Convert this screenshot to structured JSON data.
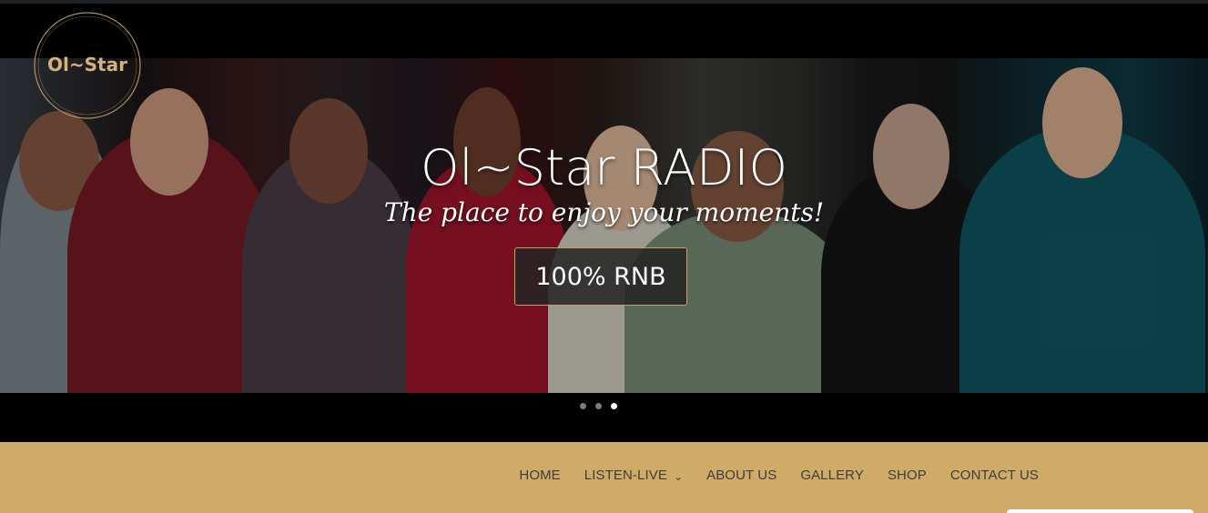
{
  "logo": {
    "text": "Ol~Star"
  },
  "hero": {
    "title": "Ol~Star RADIO",
    "tagline": "The place to enjoy your moments!",
    "cta_label": "100% RNB",
    "slides": {
      "count": 3,
      "active_index": 2
    }
  },
  "nav": {
    "items": [
      {
        "label": "HOME"
      },
      {
        "label": "LISTEN-LIVE",
        "has_dropdown": true,
        "icon": "chevron-down-icon"
      },
      {
        "label": "ABOUT US"
      },
      {
        "label": "GALLERY"
      },
      {
        "label": "SHOP"
      },
      {
        "label": "CONTACT US"
      }
    ]
  },
  "colors": {
    "nav_background": "#d0ab68",
    "accent_gold": "#c7a25c",
    "hero_background": "#000000"
  }
}
